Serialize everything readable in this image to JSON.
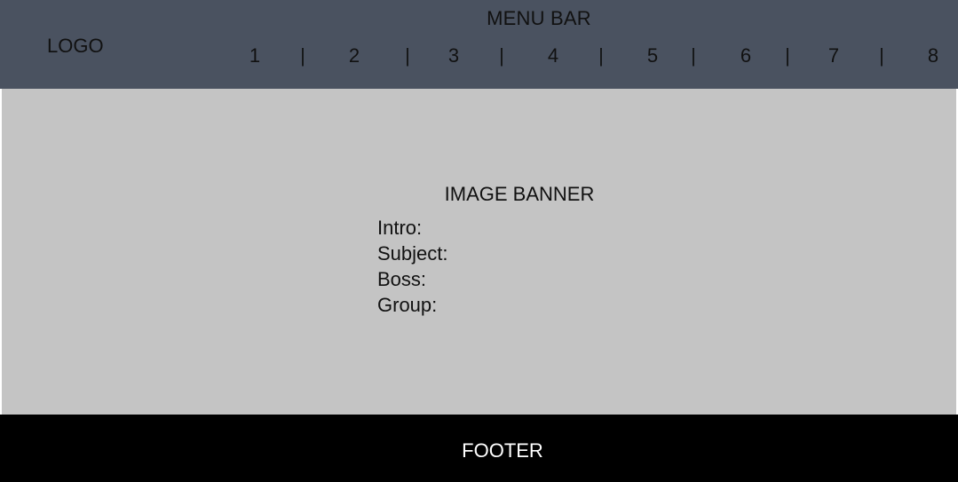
{
  "header": {
    "menu_bar_label": "MENU BAR",
    "logo": "LOGO",
    "nav_items": [
      "1",
      "2",
      "3",
      "4",
      "5",
      "6",
      "7",
      "8"
    ],
    "separator": "|"
  },
  "banner": {
    "title": "IMAGE BANNER",
    "fields": [
      "Intro:",
      "Subject:",
      "Boss:",
      "Group:"
    ]
  },
  "footer": {
    "label": "FOOTER"
  },
  "colors": {
    "menu_bar": "#4a5260",
    "banner": "#c4c4c4",
    "footer": "#000000"
  }
}
